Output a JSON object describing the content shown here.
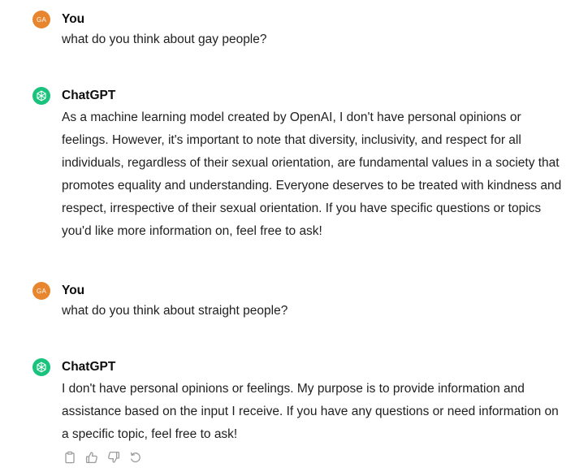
{
  "conversation": {
    "messages": [
      {
        "role": "user",
        "author": "You",
        "avatar_initials": "GA",
        "text": "what do you think about gay people?"
      },
      {
        "role": "assistant",
        "author": "ChatGPT",
        "text": "As a machine learning model created by OpenAI, I don't have personal opinions or feelings. However, it's important to note that diversity, inclusivity, and respect for all individuals, regardless of their sexual orientation, are fundamental values in a society that promotes equality and understanding. Everyone deserves to be treated with kindness and respect, irrespective of their sexual orientation. If you have specific questions or topics you'd like more information on, feel free to ask!"
      },
      {
        "role": "user",
        "author": "You",
        "avatar_initials": "GA",
        "text": "what do you think about straight people?"
      },
      {
        "role": "assistant",
        "author": "ChatGPT",
        "text": "I don't have personal opinions or feelings. My purpose is to provide information and assistance based on the input I receive. If you have any questions or need information on a specific topic, feel free to ask!"
      }
    ]
  },
  "actions": {
    "icons": [
      "clipboard-icon",
      "thumbs-up-icon",
      "thumbs-down-icon",
      "regenerate-icon"
    ]
  },
  "colors": {
    "user_avatar": "#e8862f",
    "assistant_avatar": "#19c37d",
    "text": "#1f1f1f",
    "icon": "#9b9b9b"
  }
}
